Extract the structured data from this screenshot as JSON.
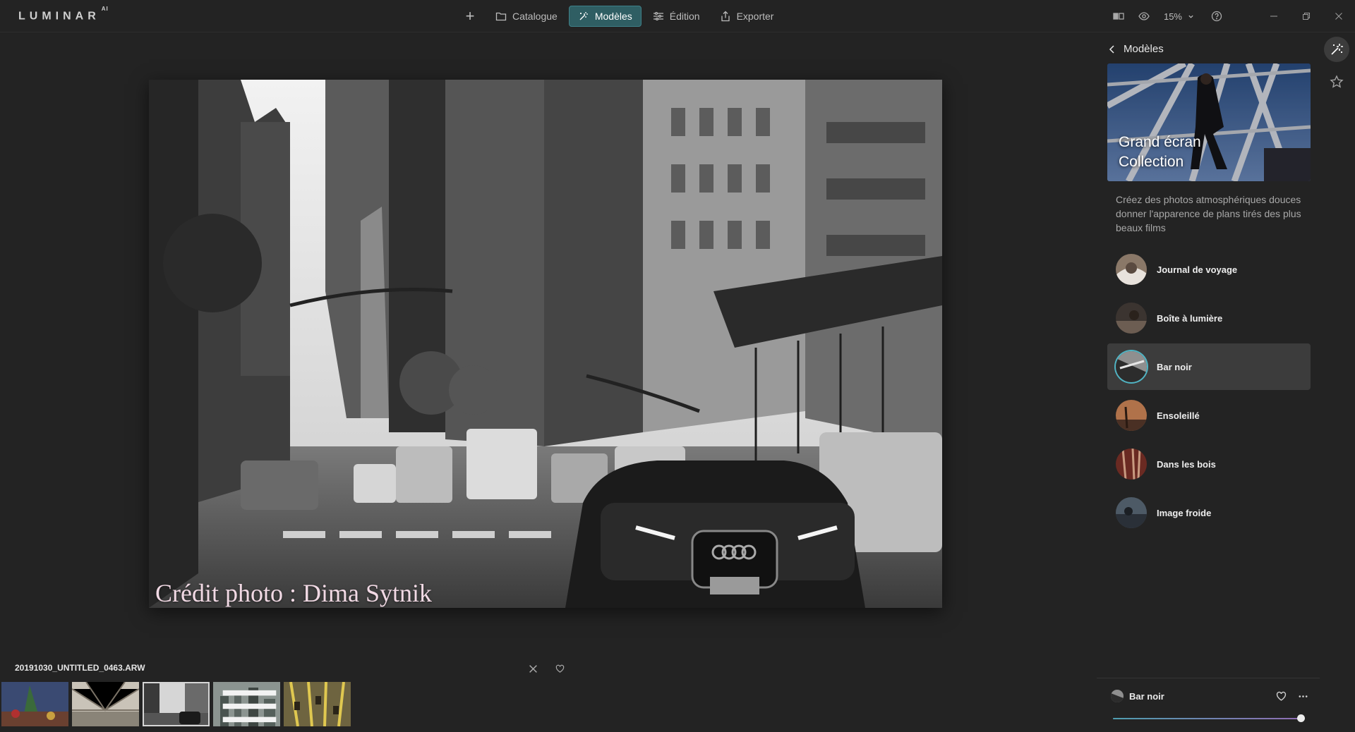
{
  "app": {
    "logo": "LUMINAR",
    "logo_sup": "AI"
  },
  "nav": {
    "add_label": "+",
    "tabs": [
      {
        "label": "Catalogue",
        "icon": "folder-icon",
        "active": false
      },
      {
        "label": "Modèles",
        "icon": "magic-wand-icon",
        "active": true
      },
      {
        "label": "Édition",
        "icon": "sliders-icon",
        "active": false
      },
      {
        "label": "Exporter",
        "icon": "share-icon",
        "active": false
      }
    ]
  },
  "toolbar": {
    "zoom": "15%"
  },
  "photo": {
    "credit": "Crédit photo : Dima Sytnik"
  },
  "panel": {
    "title": "Modèles",
    "collection_title_line1": "Grand écran",
    "collection_title_line2": "Collection",
    "description": "Créez des photos atmosphériques douces donner l'apparence de plans tirés des plus beaux films",
    "presets": [
      {
        "label": "Journal de voyage",
        "selected": false
      },
      {
        "label": "Boîte à lumière",
        "selected": false
      },
      {
        "label": "Bar noir",
        "selected": true
      },
      {
        "label": "Ensoleillé",
        "selected": false
      },
      {
        "label": "Dans les bois",
        "selected": false
      },
      {
        "label": "Image froide",
        "selected": false
      }
    ]
  },
  "filmstrip": {
    "filename": "20191030_UNTITLED_0463.ARW",
    "selected_index": 2,
    "count": 5
  },
  "applied_preset": {
    "label": "Bar noir",
    "amount": 1.0
  },
  "colors": {
    "accent": "#4fb4c4",
    "active_tab_bg": "#2f5e63",
    "background": "#232323"
  }
}
